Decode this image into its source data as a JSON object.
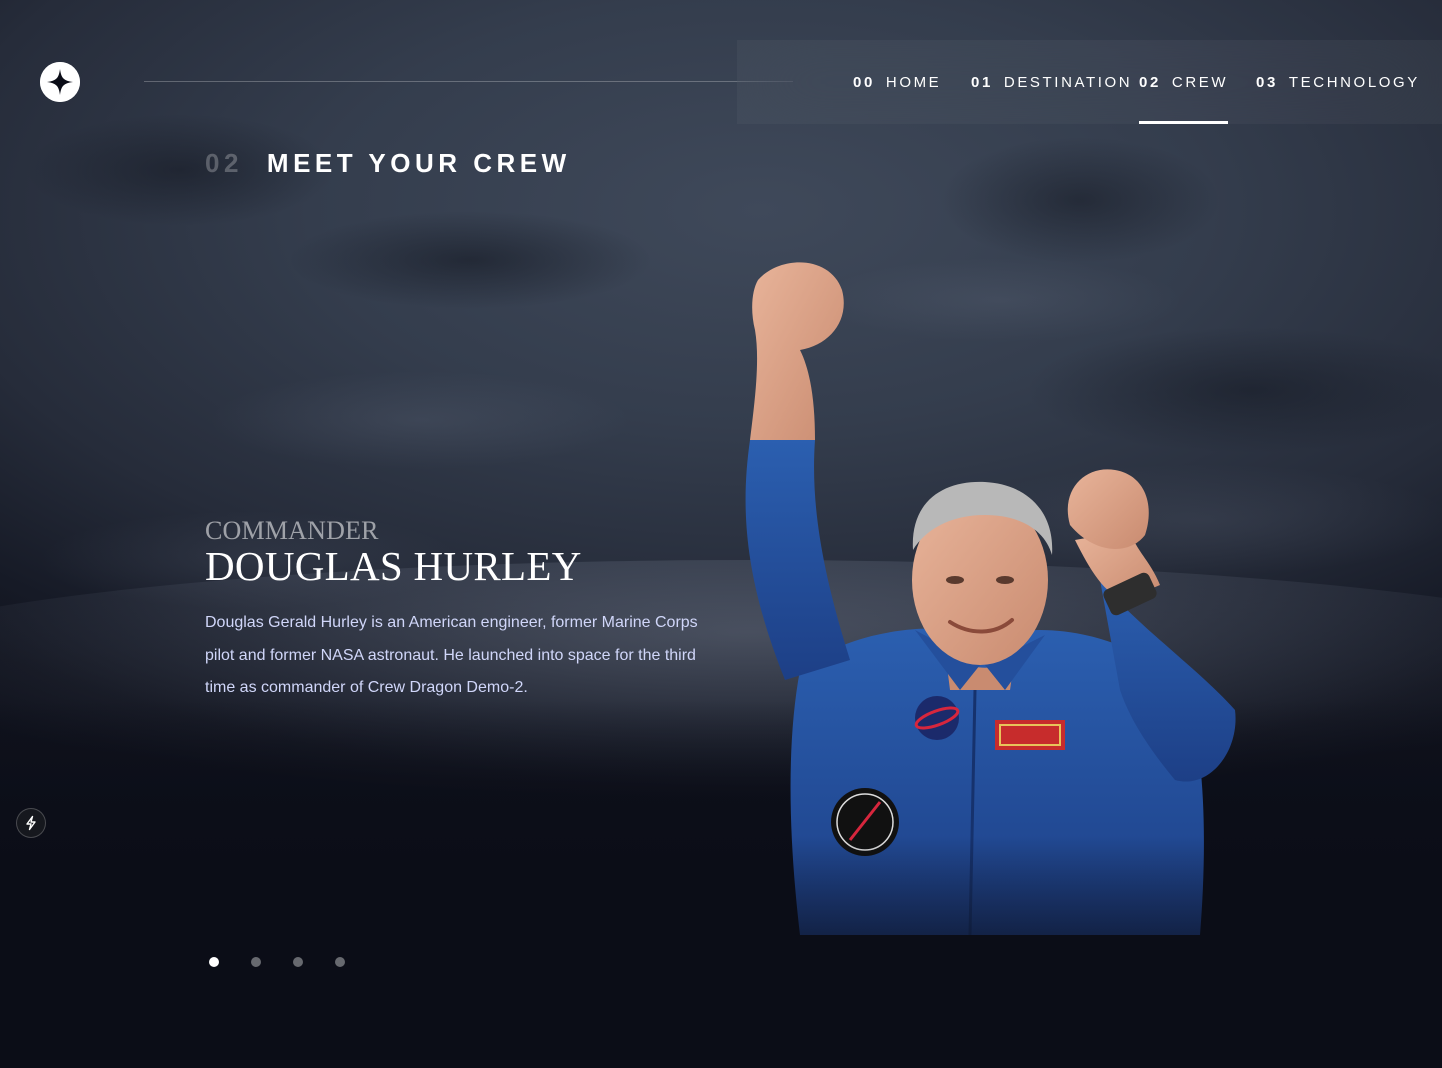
{
  "nav": {
    "items": [
      {
        "number": "00",
        "label": "HOME",
        "active": false
      },
      {
        "number": "01",
        "label": "DESTINATION",
        "active": false
      },
      {
        "number": "02",
        "label": "CREW",
        "active": true
      },
      {
        "number": "03",
        "label": "TECHNOLOGY",
        "active": false
      }
    ]
  },
  "page": {
    "number": "02",
    "title": "MEET YOUR CREW"
  },
  "crew": {
    "role": "Commander",
    "name": "Douglas Hurley",
    "bio": "Douglas Gerald Hurley is an American engineer, former Marine Corps pilot and former NASA astronaut. He launched into space for the third time as commander of Crew Dragon Demo-2.",
    "image_alt": "Douglas Hurley"
  },
  "pagination": {
    "count": 4,
    "active_index": 0
  },
  "colors": {
    "background": "#0b0d17",
    "text_light": "#d0d6f9",
    "white": "#ffffff"
  },
  "icons": {
    "logo": "star-logo-icon",
    "side_badge": "lightning-bolt-icon"
  }
}
